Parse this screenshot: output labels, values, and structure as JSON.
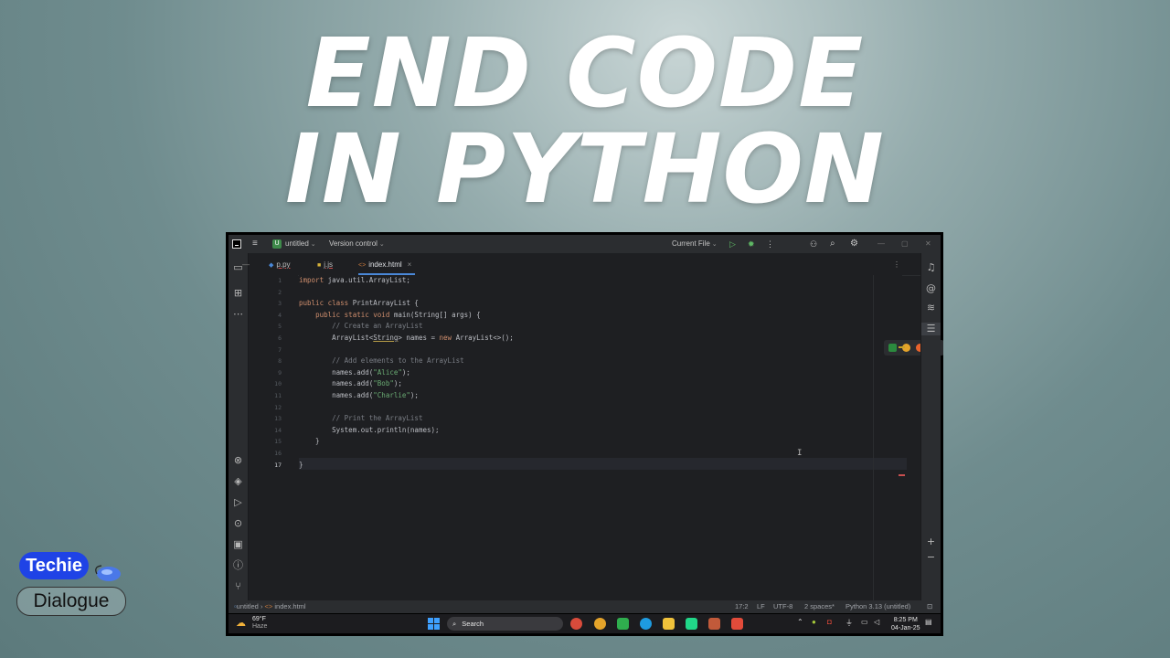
{
  "thumbnail": {
    "title_line1": "END CODE",
    "title_line2": "IN PYTHON",
    "brand_line1": "Techie",
    "brand_line2": "Dialogue"
  },
  "ide": {
    "project_name": "untitled",
    "vcs_label": "Version control",
    "run_config": "Current File",
    "tabs": [
      {
        "label": "p.py",
        "icon": "python-file-icon",
        "active": false
      },
      {
        "label": "j.js",
        "icon": "js-file-icon",
        "active": false
      },
      {
        "label": "index.html",
        "icon": "html-file-icon",
        "active": true
      }
    ],
    "inspections": {
      "errors": "1",
      "warnings": "1"
    },
    "line_numbers": [
      "1",
      "2",
      "3",
      "4",
      "5",
      "6",
      "7",
      "8",
      "9",
      "10",
      "11",
      "12",
      "13",
      "14",
      "15",
      "16",
      "17"
    ],
    "current_line": "17",
    "code_lines": [
      "import java.util.ArrayList;",
      "",
      "public class PrintArrayList {",
      "    public static void main(String[] args) {",
      "        // Create an ArrayList",
      "        ArrayList<String> names = new ArrayList<>();",
      "",
      "        // Add elements to the ArrayList",
      "        names.add(\"Alice\");",
      "        names.add(\"Bob\");",
      "        names.add(\"Charlie\");",
      "",
      "        // Print the ArrayList",
      "        System.out.println(names);",
      "    }",
      "",
      "}"
    ],
    "status_bar": {
      "breadcrumb_project": "untitled",
      "breadcrumb_file": "index.html",
      "position": "17:2",
      "line_sep": "LF",
      "encoding": "UTF-8",
      "indent": "2 spaces*",
      "interpreter": "Python 3.13 (untitled)"
    }
  },
  "taskbar": {
    "weather_temp": "69°F",
    "weather_desc": "Haze",
    "search_placeholder": "Search",
    "time": "8:25 PM",
    "date": "04-Jan-25"
  },
  "colors": {
    "accent": "#4a88d8",
    "brand_blue": "#1f43e6",
    "keyword": "#cf8e6d",
    "string": "#6aab73",
    "comment": "#7a7e85"
  }
}
